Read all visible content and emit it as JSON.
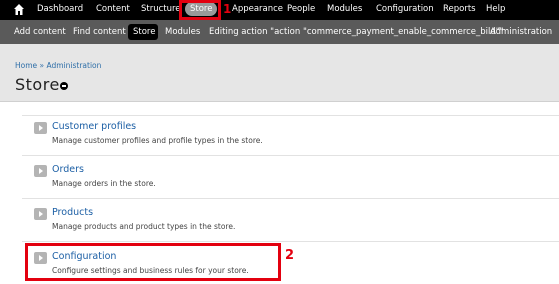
{
  "toolbar": {
    "items": [
      "Dashboard",
      "Content",
      "Structure",
      "Store",
      "Appearance",
      "People",
      "Modules",
      "Configuration",
      "Reports",
      "Help"
    ],
    "home_icon": "home-icon",
    "callout_number": "1"
  },
  "shortcuts": {
    "items": [
      "Add content",
      "Find content",
      "Store",
      "Modules",
      "Editing action \"action \"commerce_payment_enable_commerce_bild\"\"",
      "Administration"
    ]
  },
  "header": {
    "breadcrumb": "Home » Administration",
    "title": "Store"
  },
  "admin_items": [
    {
      "title": "Customer profiles",
      "description": "Manage customer profiles and profile types in the store."
    },
    {
      "title": "Orders",
      "description": "Manage orders in the store."
    },
    {
      "title": "Products",
      "description": "Manage products and product types in the store."
    },
    {
      "title": "Configuration",
      "description": "Configure settings and business rules for your store."
    }
  ],
  "callouts": {
    "second_number": "2"
  },
  "colors": {
    "toolbar": "#000000",
    "shortcuts": "#5a5a5a",
    "highlight": "#e3000f",
    "link": "#1c5fa5"
  }
}
